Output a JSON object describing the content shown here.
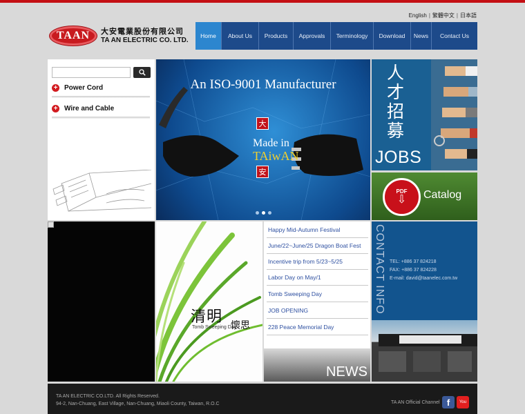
{
  "colors": {
    "brand_red": "#c40f14",
    "nav_blue": "#1d4a8a",
    "nav_active": "#2c86cf",
    "news_link": "#2d4fa0"
  },
  "header": {
    "languages": [
      "English",
      "繁體中文",
      "日本語"
    ],
    "logo_mark": "TAAN",
    "company_zh": "大安電業股份有限公司",
    "company_en": "TA AN ELECTRIC CO. LTD."
  },
  "nav": {
    "items": [
      {
        "label": "Home",
        "active": true
      },
      {
        "label": "About Us"
      },
      {
        "label": "Products"
      },
      {
        "label": "Approvals"
      },
      {
        "label": "Terminology"
      },
      {
        "label": "Download"
      },
      {
        "label": "News"
      },
      {
        "label": "Contact Us"
      }
    ]
  },
  "sidebar": {
    "search": {
      "value": "",
      "placeholder": "",
      "icon": "search-icon"
    },
    "categories": [
      {
        "label": "Power Cord",
        "icon": "plus-circle-icon"
      },
      {
        "label": "Wire and Cable",
        "icon": "plus-circle-icon"
      }
    ]
  },
  "banner": {
    "title": "An ISO-9001 Manufacturer",
    "made_in": "Made in",
    "taiwan": "TAiwAN",
    "seal_top": "大",
    "seal_bottom": "安",
    "slide_count": 3,
    "active_slide": 1
  },
  "jobs": {
    "chars": [
      "人",
      "才",
      "招",
      "募"
    ],
    "label": "JOBS"
  },
  "catalog": {
    "icon_text": "PDF",
    "label": "Catalog"
  },
  "tomb": {
    "zh": "清明",
    "en": "Tomb Sweeping Day",
    "zh2": "懷思"
  },
  "news": {
    "items": [
      "Happy Mid-Autumn Festival",
      "June/22~June/25 Dragon Boat Fest",
      "Incentive trip from 5/23~5/25",
      "Labor Day on May/1",
      "Tomb Sweeping Day",
      "JOB OPENING",
      "228 Peace Memorial Day"
    ],
    "footer_label": "NEWS"
  },
  "contact": {
    "title": "CONTACT INFO",
    "tel": "TEL: +886 37 824218",
    "fax": "FAX: +886 37 824228",
    "email": "E-mail: david@taanelec.com.tw"
  },
  "footer": {
    "copyright": "TA AN ELECTRIC CO.LTD. All Rights Reserved.",
    "address": "94-2, Nan-Chuang, East Village, Nan-Chuang, Miaoli County, Taiwan, R.O.C",
    "channel_label": "TA AN Official Channel",
    "facebook_letter": "f",
    "youtube_text": "You"
  }
}
